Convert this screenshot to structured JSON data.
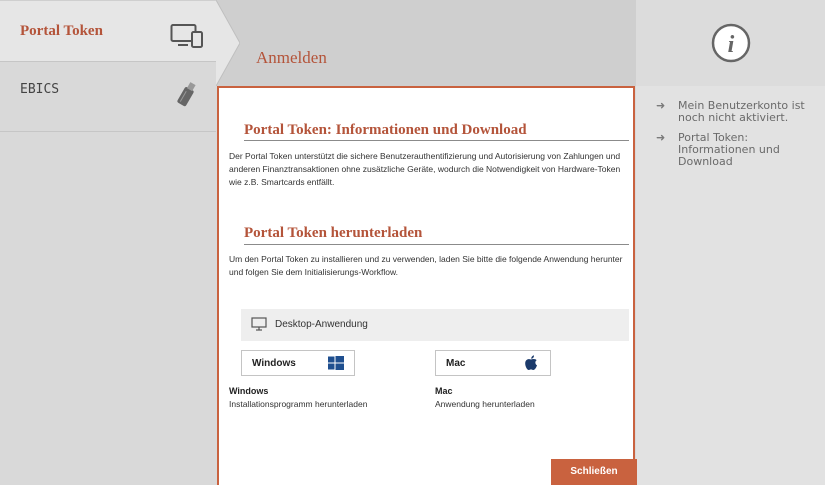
{
  "sidebar": {
    "items": [
      {
        "label": "Portal Token",
        "icon": "devices-icon",
        "active": true
      },
      {
        "label": "EBICS",
        "icon": "usb-stick-icon",
        "active": false
      }
    ]
  },
  "header": {
    "title": "Anmelden"
  },
  "info_panel": {
    "icon": "info-icon",
    "items": [
      "Mein Benutzerkonto ist noch nicht aktiviert.",
      "Portal Token: Informationen und Download"
    ]
  },
  "modal": {
    "info_title": "Portal Token: Informationen und Download",
    "info_text": "Der Portal Token unterstützt die sichere Benutzerauthentifizierung und Autorisierung von Zahlungen und anderen Finanztransaktionen ohne zusätzliche Geräte, wodurch die Notwendigkeit von Hardware-Token wie z.B. Smartcards entfällt.",
    "download_title": "Portal Token herunterladen",
    "download_text": "Um den Portal Token zu installieren und zu verwenden, laden Sie bitte die folgende Anwendung herunter und folgen Sie dem Initialisierungs-Workflow.",
    "desktop_label": "Desktop-Anwendung",
    "windows": {
      "button": "Windows",
      "name": "Windows",
      "desc": "Installationsprogramm herunterladen"
    },
    "mac": {
      "button": "Mac",
      "name": "Mac",
      "desc": "Anwendung herunterladen"
    },
    "close_label": "Schließen"
  },
  "colors": {
    "accent": "#c9623f",
    "title": "#b4543a",
    "windows_blue": "#1f4f8f",
    "mac_blue": "#1b3a6b"
  }
}
